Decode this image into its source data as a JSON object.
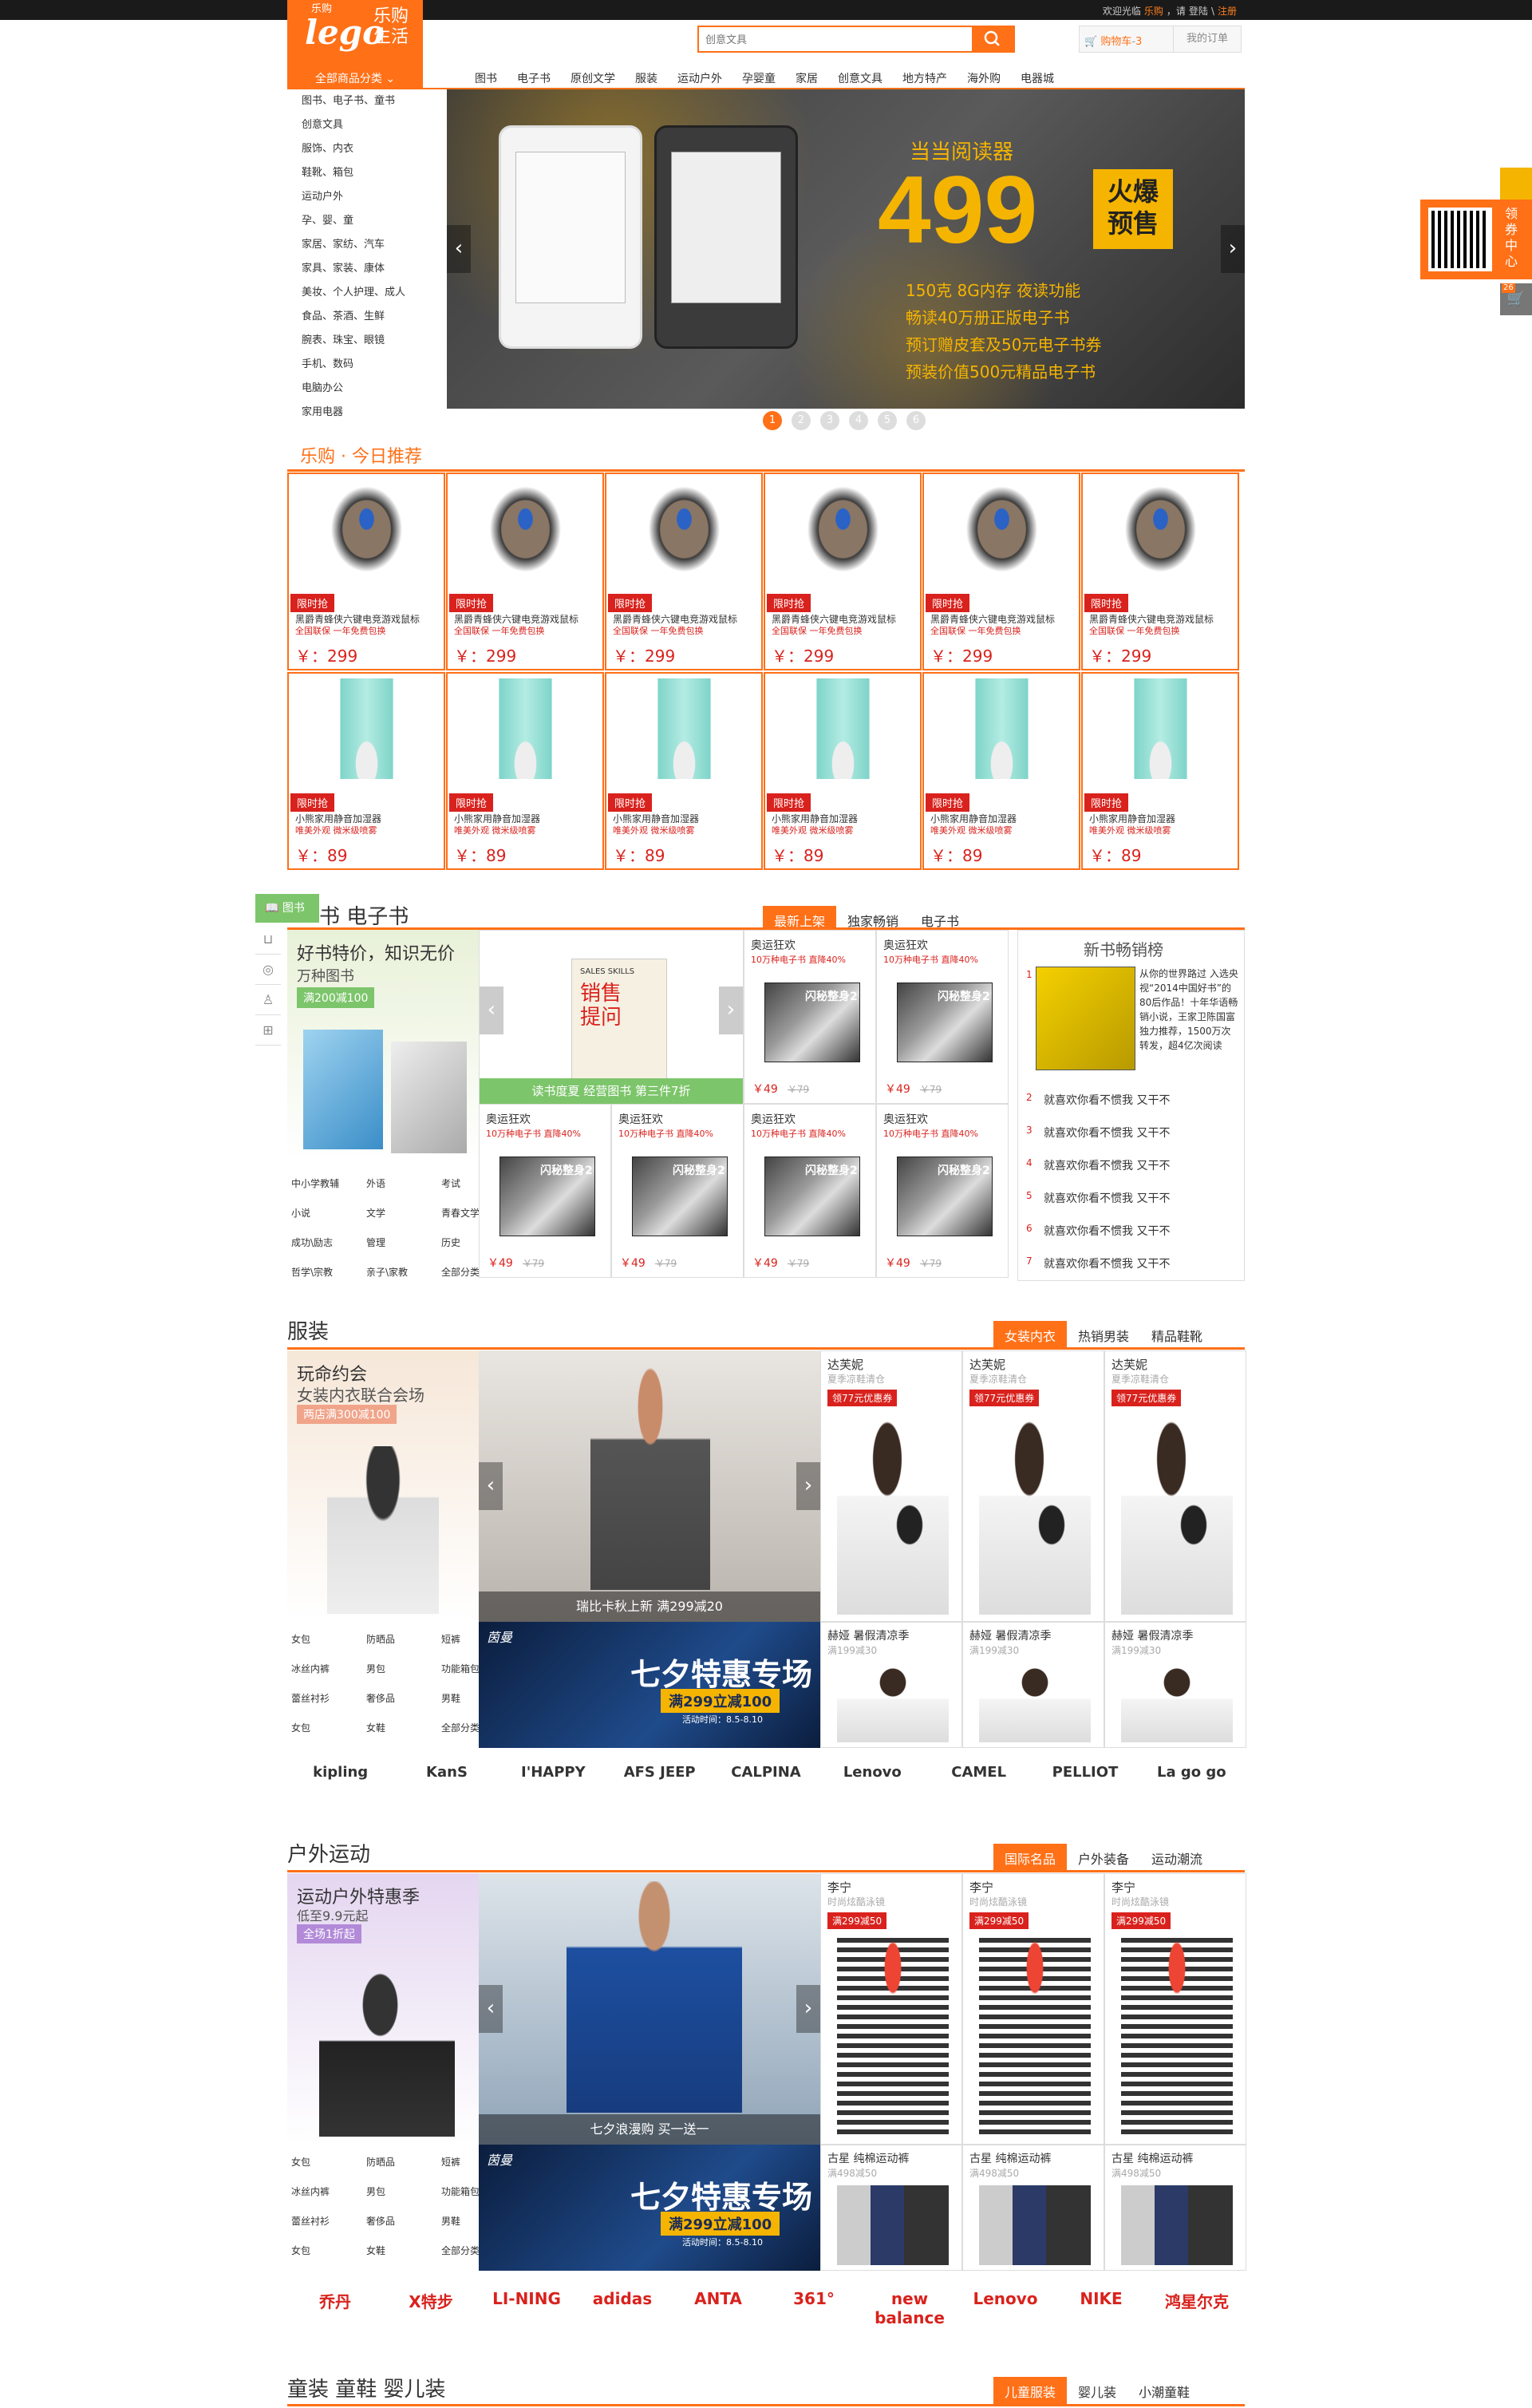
{
  "topbar": {
    "welcome": "欢迎光临",
    "site": "乐购",
    "sep": "，请",
    "login": "登陆",
    "pipe": "\\",
    "register": "注册"
  },
  "logo": {
    "brand_en": "lego",
    "brand_cn": "乐购生活",
    "top_small": "乐购"
  },
  "search": {
    "placeholder": "创意文具"
  },
  "cart": {
    "label": "购物车",
    "count": "3"
  },
  "orders": {
    "label": "我的订单"
  },
  "allcat": {
    "label": "全部商品分类"
  },
  "nav": [
    "图书",
    "电子书",
    "原创文学",
    "服装",
    "运动户外",
    "孕婴童",
    "家居",
    "创意文具",
    "地方特产",
    "海外购",
    "电器城"
  ],
  "categories": [
    "图书、电子书、童书",
    "创意文具",
    "服饰、内衣",
    "鞋靴、箱包",
    "运动户外",
    "孕、婴、童",
    "家居、家纺、汽车",
    "家具、家装、康体",
    "美妆、个人护理、成人",
    "食品、茶酒、生鲜",
    "腕表、珠宝、眼镜",
    "手机、数码",
    "电脑办公",
    "家用电器"
  ],
  "banner": {
    "heading": "当当阅读器",
    "price": "499",
    "badge1": "火爆",
    "badge2": "预售",
    "points": [
      "150克 8G内存 夜读功能",
      "畅读40万册正版电子书",
      "预订赠皮套及50元电子书券",
      "预装价值500元精品电子书"
    ]
  },
  "dots": [
    "1",
    "2",
    "3",
    "4",
    "5",
    "6"
  ],
  "today": {
    "title": "乐购 · 今日推荐"
  },
  "products_row1": [
    {
      "tag": "限时抢",
      "name": "黑爵青蜂侠六键电竞游戏鼠标",
      "sub": "全国联保 一年免费包换",
      "price": "￥：299"
    },
    {
      "tag": "限时抢",
      "name": "黑爵青蜂侠六键电竞游戏鼠标",
      "sub": "全国联保 一年免费包换",
      "price": "￥：299"
    },
    {
      "tag": "限时抢",
      "name": "黑爵青蜂侠六键电竞游戏鼠标",
      "sub": "全国联保 一年免费包换",
      "price": "￥：299"
    },
    {
      "tag": "限时抢",
      "name": "黑爵青蜂侠六键电竞游戏鼠标",
      "sub": "全国联保 一年免费包换",
      "price": "￥：299"
    },
    {
      "tag": "限时抢",
      "name": "黑爵青蜂侠六键电竞游戏鼠标",
      "sub": "全国联保 一年免费包换",
      "price": "￥：299"
    },
    {
      "tag": "限时抢",
      "name": "黑爵青蜂侠六键电竞游戏鼠标",
      "sub": "全国联保 一年免费包换",
      "price": "￥：299"
    }
  ],
  "products_row2": [
    {
      "tag": "限时抢",
      "name": "小熊家用静音加湿器",
      "sub": "唯美外观 微米级喷雾",
      "price": "￥：89"
    },
    {
      "tag": "限时抢",
      "name": "小熊家用静音加湿器",
      "sub": "唯美外观 微米级喷雾",
      "price": "￥：89"
    },
    {
      "tag": "限时抢",
      "name": "小熊家用静音加湿器",
      "sub": "唯美外观 微米级喷雾",
      "price": "￥：89"
    },
    {
      "tag": "限时抢",
      "name": "小熊家用静音加湿器",
      "sub": "唯美外观 微米级喷雾",
      "price": "￥：89"
    },
    {
      "tag": "限时抢",
      "name": "小熊家用静音加湿器",
      "sub": "唯美外观 微米级喷雾",
      "price": "￥：89"
    },
    {
      "tag": "限时抢",
      "name": "小熊家用静音加湿器",
      "sub": "唯美外观 微米级喷雾",
      "price": "￥：89"
    }
  ],
  "sidenav": {
    "active": "图书"
  },
  "books": {
    "title": "书 电子书",
    "tabs": [
      "最新上架",
      "独家畅销",
      "电子书"
    ],
    "promo_title": "好书特价，知识无价",
    "promo_sub": "万种图书",
    "promo_badge": "满200减100",
    "slider_caption": "读书度夏 经营图书 第三件7折",
    "slide_book_title": "销售提问",
    "slide_book_tag": "SALES SKILLS",
    "subcats": [
      [
        "中小学教辅",
        "外语",
        "考试"
      ],
      [
        "小说",
        "文学",
        "青春文学"
      ],
      [
        "成功\\励志",
        "管理",
        "历史"
      ],
      [
        "哲学\\宗教",
        "亲子\\家教",
        "全部分类>"
      ]
    ],
    "card_name": "奥运狂欢",
    "card_sub": "10万种电子书 直降40%",
    "card_cover": "闪秘整身2",
    "price_now": "￥49",
    "price_old": "￥79",
    "rank_title": "新书畅销榜",
    "rank_first": "从你的世界路过 入选央视“2014中国好书”的80后作品！十年华语畅销小说，王家卫陈国富独力推荐，1500万次转发，超4亿次阅读",
    "rank_items": [
      [
        "2",
        "就喜欢你看不惯我",
        "又干不"
      ],
      [
        "3",
        "就喜欢你看不惯我",
        "又干不"
      ],
      [
        "4",
        "就喜欢你看不惯我",
        "又干不"
      ],
      [
        "5",
        "就喜欢你看不惯我",
        "又干不"
      ],
      [
        "6",
        "就喜欢你看不惯我",
        "又干不"
      ],
      [
        "7",
        "就喜欢你看不惯我",
        "又干不"
      ]
    ]
  },
  "clothing": {
    "title": "服装",
    "tabs": [
      "女装内衣",
      "热销男装",
      "精品鞋靴"
    ],
    "promo_title": "玩命约会",
    "promo_sub": "女装内衣联合会场",
    "promo_badge": "两店满300减100",
    "slider_caption": "瑞比卡秋上新 满299减20",
    "sale_title": "七夕特惠专场",
    "sale_sub": "满299立减100",
    "sale_date": "活动时间：8.5-8.10",
    "sale_brand": "茵曼",
    "subcats": [
      [
        "女包",
        "防晒品",
        "短裤"
      ],
      [
        "冰丝内裤",
        "男包",
        "功能箱包"
      ],
      [
        "蕾丝衬衫",
        "奢侈品",
        "男鞋"
      ],
      [
        "女包",
        "女鞋",
        "全部分类>"
      ]
    ],
    "cards": [
      {
        "brand": "达芙妮",
        "sub": "夏季凉鞋清仓",
        "coupon": "领77元优惠券"
      },
      {
        "brand": "达芙妮",
        "sub": "夏季凉鞋清仓",
        "coupon": "领77元优惠券"
      },
      {
        "brand": "达芙妮",
        "sub": "夏季凉鞋清仓",
        "coupon": "领77元优惠券"
      }
    ],
    "small": [
      {
        "brand": "赫娅 暑假清凉季",
        "sub": "满199减30"
      },
      {
        "brand": "赫娅 暑假清凉季",
        "sub": "满199减30"
      },
      {
        "brand": "赫娅 暑假清凉季",
        "sub": "满199减30"
      }
    ],
    "brands": [
      "kipling",
      "KanS",
      "I'HAPPY",
      "AFS JEEP",
      "CALPINA",
      "Lenovo",
      "CAMEL",
      "PELLIOT",
      "La go go"
    ]
  },
  "outdoor": {
    "title": "户外运动",
    "tabs": [
      "国际名品",
      "户外装备",
      "运动潮流"
    ],
    "promo_title": "运动户外特惠季",
    "promo_sub": "低至9.9元起",
    "promo_badge": "全场1折起",
    "slider_caption": "七夕浪漫购 买一送一",
    "sale_title": "七夕特惠专场",
    "sale_sub": "满299立减100",
    "sale_date": "活动时间：8.5-8.10",
    "sale_brand": "茵曼",
    "subcats": [
      [
        "女包",
        "防晒品",
        "短裤"
      ],
      [
        "冰丝内裤",
        "男包",
        "功能箱包"
      ],
      [
        "蕾丝衬衫",
        "奢侈品",
        "男鞋"
      ],
      [
        "女包",
        "女鞋",
        "全部分类>"
      ]
    ],
    "cards": [
      {
        "brand": "李宁",
        "sub": "时尚炫酷泳镜",
        "coupon": "满299减50"
      },
      {
        "brand": "李宁",
        "sub": "时尚炫酷泳镜",
        "coupon": "满299减50"
      },
      {
        "brand": "李宁",
        "sub": "时尚炫酷泳镜",
        "coupon": "满299减50"
      }
    ],
    "small": [
      {
        "brand": "古星 纯棉运动裤",
        "sub": "满498减50"
      },
      {
        "brand": "古星 纯棉运动裤",
        "sub": "满498减50"
      },
      {
        "brand": "古星 纯棉运动裤",
        "sub": "满498减50"
      }
    ],
    "brands": [
      "乔丹",
      "X特步",
      "LI-NING",
      "adidas",
      "ANTA",
      "361°",
      "new balance",
      "Lenovo",
      "NIKE",
      "鸿星尔克"
    ]
  },
  "kids": {
    "title": "童装 童鞋 婴儿装",
    "tabs": [
      "儿童服装",
      "婴儿装",
      "小潮童鞋"
    ]
  },
  "float": {
    "coupon": "领券中心",
    "cart_count": "26"
  }
}
